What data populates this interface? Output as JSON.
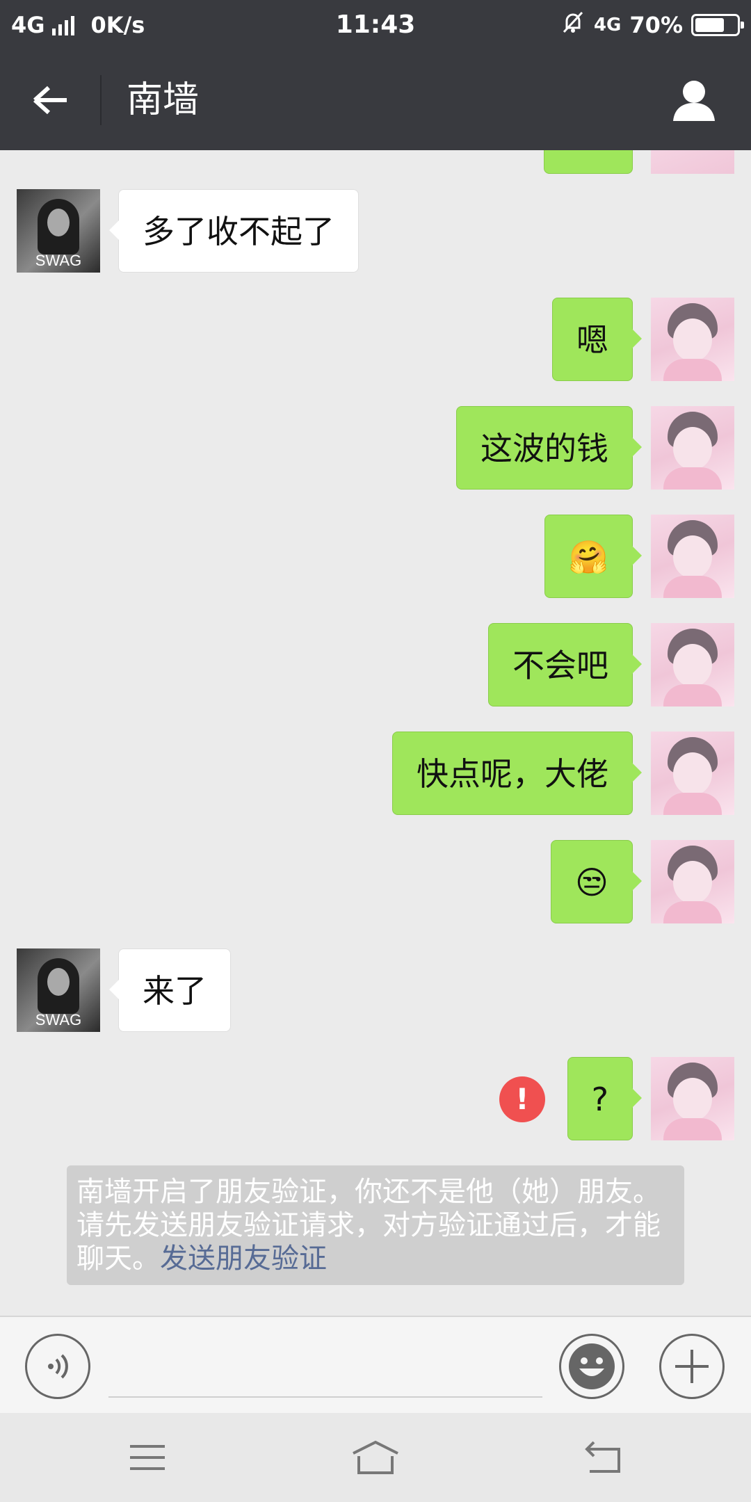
{
  "status_bar": {
    "network": "4G",
    "speed": "0K/s",
    "time": "11:43",
    "network_right": "4G",
    "battery": "70%",
    "battery_level": 0.7
  },
  "header": {
    "title": "南墙"
  },
  "messages": [
    {
      "side": "left",
      "text": "多了收不起了"
    },
    {
      "side": "right",
      "text": "嗯"
    },
    {
      "side": "right",
      "text": "这波的钱"
    },
    {
      "side": "right",
      "text": "🤗"
    },
    {
      "side": "right",
      "text": "不会吧"
    },
    {
      "side": "right",
      "text": "快点呢，大佬"
    },
    {
      "side": "right",
      "text": "😒"
    },
    {
      "side": "left",
      "text": "来了"
    },
    {
      "side": "right",
      "text": "?",
      "status": "!"
    }
  ],
  "avatar_left_caption": "SWAG",
  "system_notice": {
    "text": "南墙开启了朋友验证，你还不是他（她）朋友。请先发送朋友验证请求，对方验证通过后，才能聊天。",
    "link": "发送朋友验证"
  },
  "input": {
    "placeholder": ""
  },
  "colors": {
    "bar": "#393a3f",
    "sent_bubble": "#9fe65b",
    "received_bubble": "#ffffff",
    "error": "#f05050",
    "link": "#576b95"
  }
}
